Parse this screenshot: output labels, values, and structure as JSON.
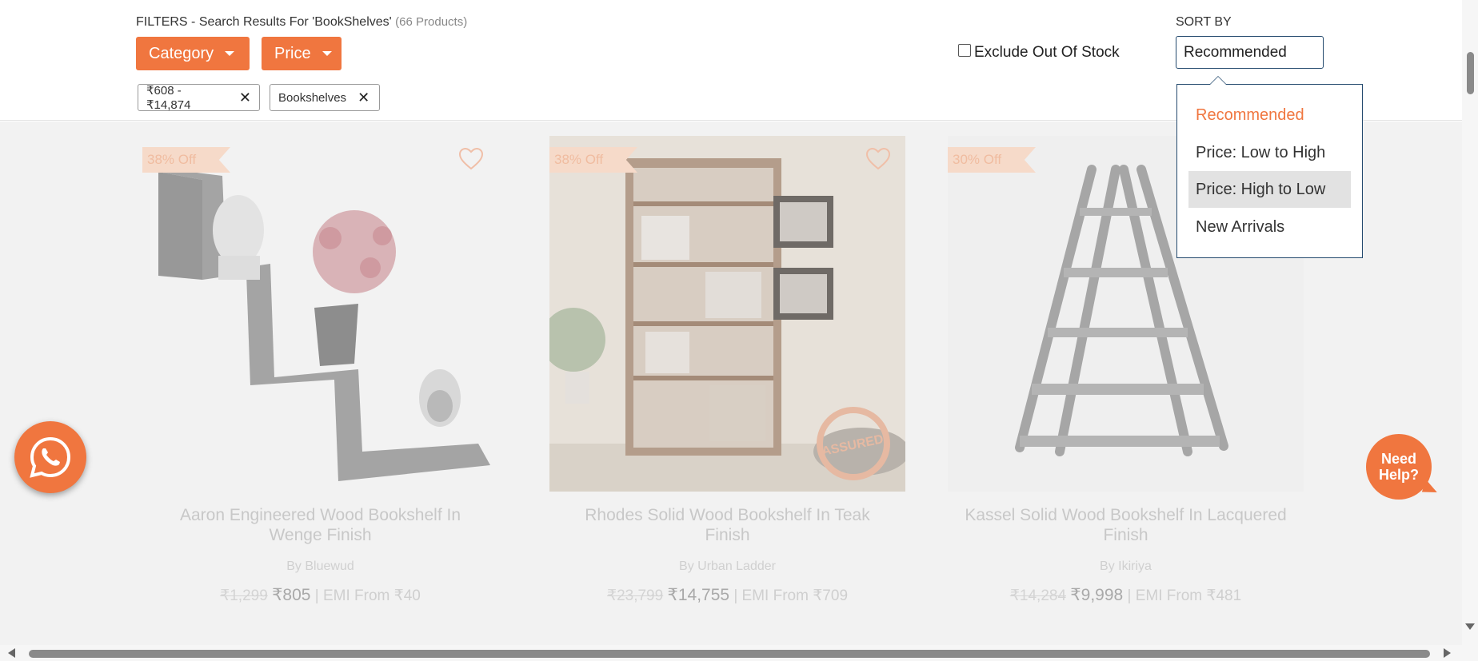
{
  "filters": {
    "heading": "FILTERS - Search Results For 'BookShelves'",
    "count": "(66 Products)",
    "category_label": "Category",
    "price_label": "Price",
    "chips": [
      {
        "label": "₹608 - ₹14,874"
      },
      {
        "label": "Bookshelves"
      }
    ],
    "exclude_out_of_stock": "Exclude Out Of Stock",
    "exclude_checked": false
  },
  "sort": {
    "label": "SORT BY",
    "selected": "Recommended",
    "options": [
      "Recommended",
      "Price: Low to High",
      "Price: High to Low",
      "New Arrivals"
    ],
    "active_index": 0,
    "hover_index": 2
  },
  "products": [
    {
      "discount": "38% Off",
      "title": "Aaron Engineered Wood Bookshelf In Wenge Finish",
      "brand": "By Bluewud",
      "mrp": "₹1,299",
      "price": "₹805",
      "emi": "| EMI From ₹40"
    },
    {
      "discount": "38% Off",
      "title": "Rhodes Solid Wood Bookshelf In Teak Finish",
      "brand": "By Urban Ladder",
      "mrp": "₹23,799",
      "price": "₹14,755",
      "emi": "| EMI From ₹709",
      "stamp": "ASSURED"
    },
    {
      "discount": "30% Off",
      "title": "Kassel Solid Wood Bookshelf In Lacquered Finish",
      "brand": "By Ikiriya",
      "mrp": "₹14,284",
      "price": "₹9,998",
      "emi": "| EMI From ₹481"
    }
  ],
  "help": {
    "line1": "Need",
    "line2": "Help?"
  },
  "colors": {
    "accent": "#f0763f",
    "select_border": "#244a6e",
    "overlay": "#f2f2f2"
  }
}
